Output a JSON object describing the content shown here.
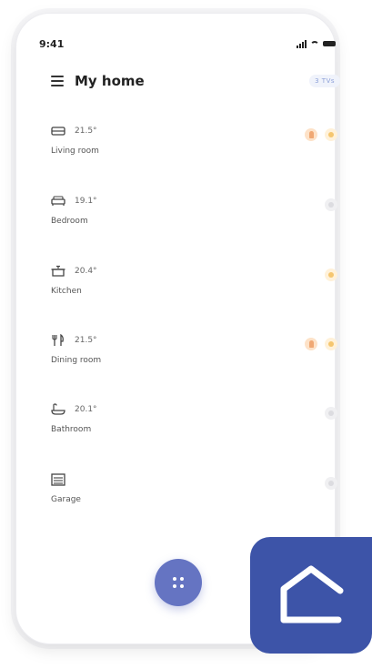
{
  "status_bar": {
    "time": "9:41"
  },
  "header": {
    "title": "My home",
    "badge": "3 TVs"
  },
  "rooms": [
    {
      "name": "Living room",
      "temp": "21.5°",
      "icon": "sofa-icon",
      "indicators": [
        "person",
        "light"
      ]
    },
    {
      "name": "Bedroom",
      "temp": "19.1°",
      "icon": "bed-icon",
      "indicators": [
        "off"
      ]
    },
    {
      "name": "Kitchen",
      "temp": "20.4°",
      "icon": "pot-icon",
      "indicators": [
        "light"
      ]
    },
    {
      "name": "Dining room",
      "temp": "21.5°",
      "icon": "cutlery-icon",
      "indicators": [
        "person",
        "light"
      ]
    },
    {
      "name": "Bathroom",
      "temp": "20.1°",
      "icon": "bathtub-icon",
      "indicators": [
        "off"
      ]
    },
    {
      "name": "Garage",
      "temp": "",
      "icon": "garage-icon",
      "indicators": [
        "off"
      ]
    }
  ],
  "colors": {
    "accent": "#6574c2",
    "app_icon": "#3d54a8",
    "presence": "#f0a874",
    "light_on": "#f5c66f"
  }
}
